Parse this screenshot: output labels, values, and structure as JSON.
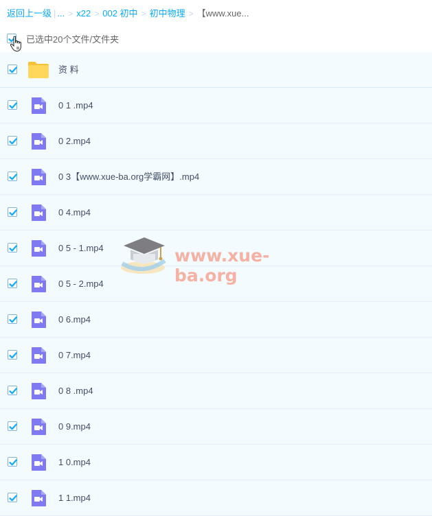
{
  "breadcrumb": {
    "back": "返回上一级",
    "ellipsis": "...",
    "items": [
      "x22",
      "002 初中",
      "初中物理"
    ],
    "current": "【www.xue..."
  },
  "selection": {
    "text": "已选中20个文件/文件夹",
    "checked": true
  },
  "files": [
    {
      "name": "资 料",
      "type": "folder",
      "checked": true
    },
    {
      "name": "0 1 .mp4",
      "type": "video",
      "checked": true
    },
    {
      "name": "0 2.mp4",
      "type": "video",
      "checked": true
    },
    {
      "name": "0 3【www.xue-ba.org学霸网】.mp4",
      "type": "video",
      "checked": true
    },
    {
      "name": "0 4.mp4",
      "type": "video",
      "checked": true
    },
    {
      "name": "0 5 - 1.mp4",
      "type": "video",
      "checked": true
    },
    {
      "name": "0 5 - 2.mp4",
      "type": "video",
      "checked": true
    },
    {
      "name": "0 6.mp4",
      "type": "video",
      "checked": true
    },
    {
      "name": "0 7.mp4",
      "type": "video",
      "checked": true
    },
    {
      "name": "0 8 .mp4",
      "type": "video",
      "checked": true
    },
    {
      "name": "0 9.mp4",
      "type": "video",
      "checked": true
    },
    {
      "name": "1 0.mp4",
      "type": "video",
      "checked": true
    },
    {
      "name": "1 1.mp4",
      "type": "video",
      "checked": true
    }
  ],
  "watermark": {
    "text": "www.xue-ba.org"
  },
  "colors": {
    "link": "#09aaff",
    "check": "#09aaff",
    "folder": "#ffd75a",
    "video": "#7f79f2",
    "row_bg": "#f4fbff"
  }
}
